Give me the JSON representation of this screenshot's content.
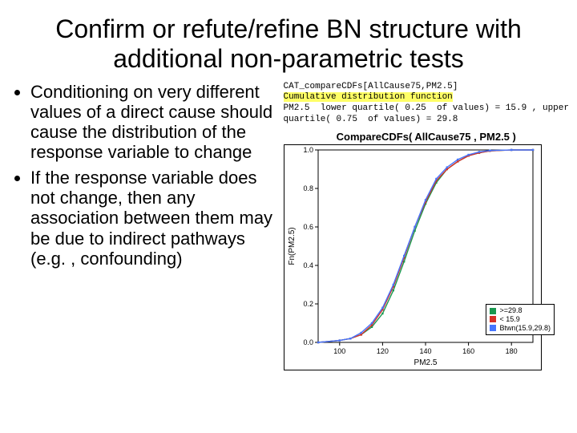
{
  "title": "Confirm or refute/refine BN structure with additional non-parametric tests",
  "bullets": [
    "Conditioning on very different values of a direct cause should cause the distribution of the response variable to change",
    "If the response variable does not change, then any association between them may be due to indirect pathways (e.g. , confounding)"
  ],
  "code_header": {
    "line1": "CAT_compareCDFs[AllCause75,PM2.5]",
    "line2_hl": "Cumulative distribution function",
    "line3": "PM2.5  lower quartile( 0.25  of values) = 15.9 , upper",
    "line4": "quartile( 0.75  of values) = 29.8"
  },
  "plot_title": "CompareCDFs( AllCause75 , PM2.5 )",
  "xlabel": "PM2.5",
  "ylabel": "Fn(PM2.5)",
  "legend": [
    {
      "label": ">=29.8",
      "color": "#1a9850"
    },
    {
      "label": "< 15.9",
      "color": "#d73027"
    },
    {
      "label": "Btwn(15.9,29.8)",
      "color": "#4575ff"
    }
  ],
  "chart_data": {
    "type": "line",
    "title": "CompareCDFs( AllCause75 , PM2.5 )",
    "xlabel": "PM2.5",
    "ylabel": "Fn(PM2.5)",
    "xlim": [
      90,
      190
    ],
    "ylim": [
      0.0,
      1.0
    ],
    "xticks": [
      100,
      120,
      140,
      160,
      180
    ],
    "yticks": [
      0.0,
      0.2,
      0.4,
      0.6,
      0.8,
      1.0
    ],
    "x": [
      90,
      100,
      105,
      110,
      115,
      120,
      125,
      130,
      135,
      140,
      145,
      150,
      155,
      160,
      165,
      170,
      180,
      190
    ],
    "series": [
      {
        "name": ">=29.8",
        "color": "#1a9850",
        "values": [
          0.0,
          0.01,
          0.02,
          0.04,
          0.08,
          0.15,
          0.27,
          0.42,
          0.58,
          0.72,
          0.83,
          0.9,
          0.94,
          0.97,
          0.985,
          0.995,
          1.0,
          1.0
        ]
      },
      {
        "name": "< 15.9",
        "color": "#d73027",
        "values": [
          0.0,
          0.01,
          0.02,
          0.04,
          0.09,
          0.17,
          0.29,
          0.44,
          0.6,
          0.73,
          0.84,
          0.9,
          0.94,
          0.97,
          0.985,
          0.995,
          1.0,
          1.0
        ]
      },
      {
        "name": "Btwn(15.9,29.8)",
        "color": "#4575ff",
        "values": [
          0.0,
          0.01,
          0.02,
          0.05,
          0.1,
          0.18,
          0.3,
          0.45,
          0.6,
          0.74,
          0.85,
          0.91,
          0.95,
          0.975,
          0.99,
          0.997,
          1.0,
          1.0
        ]
      }
    ]
  }
}
